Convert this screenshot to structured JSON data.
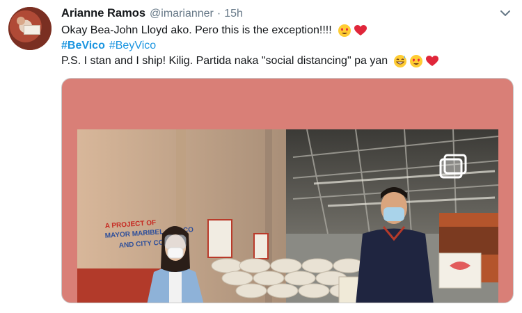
{
  "tweet": {
    "author_name": "Arianne Ramos",
    "handle": "@imarianner",
    "separator": "·",
    "timestamp": "15h",
    "line1": "Okay Bea-John Lloyd ako. Pero this is the exception!!!!",
    "hashtags": [
      "#BeVico",
      "#BeyVico"
    ],
    "line3": "P.S. I stan and I ship! Kilig. Partida naka \"social distancing\" pa yan"
  },
  "media": {
    "sign_text": "A PROJECT OF MAYOR MARIBEL A. ELCO AND CITY COUNCIL"
  },
  "colors": {
    "link": "#1b95e0",
    "muted": "#657786",
    "media_background": "#d97f77"
  },
  "icons": {
    "line1_emojis": [
      "heart-eyes-emoji",
      "red-heart-emoji"
    ],
    "line3_emojis": [
      "grinning-sweat-emoji",
      "heart-eyes-emoji",
      "red-heart-emoji"
    ],
    "menu": "chevron-down-icon",
    "media_overlay": "multiple-photos-icon"
  }
}
